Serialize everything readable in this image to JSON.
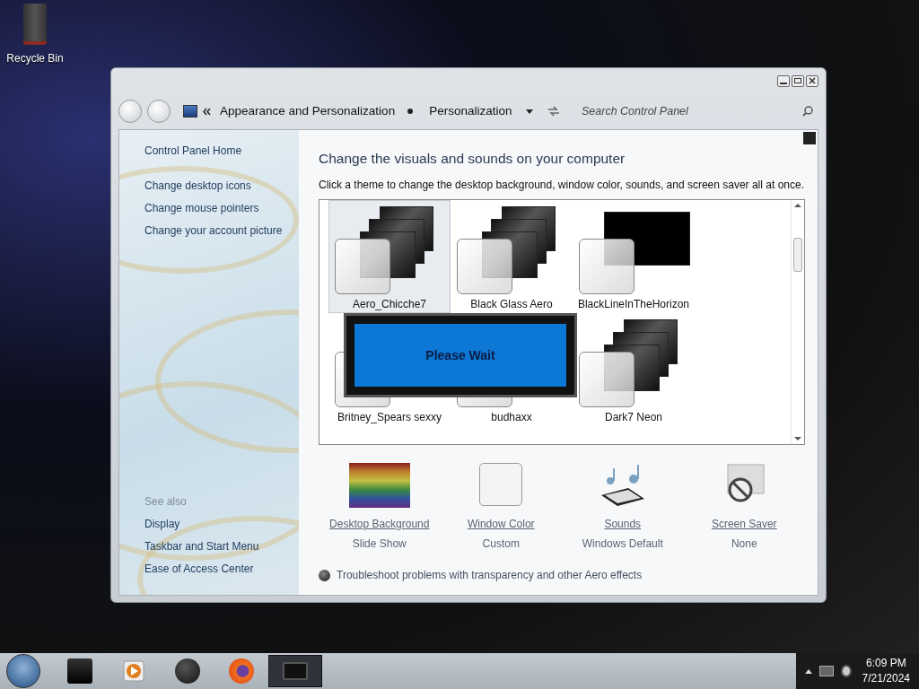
{
  "desktop_icons": [
    {
      "label": "Recycle Bin"
    }
  ],
  "window": {
    "crumbs": [
      "Appearance and Personalization",
      "Personalization"
    ],
    "search": {
      "placeholder": "Search Control Panel"
    },
    "sidebar": {
      "links": [
        "Control Panel Home",
        "Change desktop icons",
        "Change mouse pointers",
        "Change your account picture"
      ],
      "see_also_heading": "See also",
      "see_also": [
        "Display",
        "Taskbar and Start Menu",
        "Ease of Access Center"
      ]
    },
    "heading": "Change the visuals and sounds on your computer",
    "description": "Click a theme to change the desktop background, window color, sounds, and screen saver all at once.",
    "themes": [
      {
        "name": "Aero_Chicche7",
        "selected": true,
        "kind": "stack"
      },
      {
        "name": "Black Glass Aero",
        "selected": false,
        "kind": "stack"
      },
      {
        "name": "BlackLineInTheHorizon",
        "selected": false,
        "kind": "single"
      },
      {
        "name": "Britney_Spears sexxy",
        "selected": false,
        "kind": "blank"
      },
      {
        "name": "budhaxx",
        "selected": false,
        "kind": "blank"
      },
      {
        "name": "Dark7 Neon",
        "selected": false,
        "kind": "stack"
      }
    ],
    "overlay": {
      "text": "Please Wait"
    },
    "settings": [
      {
        "kind": "background",
        "title": "Desktop Background",
        "value": "Slide Show"
      },
      {
        "kind": "color",
        "title": "Window Color",
        "value": "Custom"
      },
      {
        "kind": "sounds",
        "title": "Sounds",
        "value": "Windows Default"
      },
      {
        "kind": "saver",
        "title": "Screen Saver",
        "value": "None"
      }
    ],
    "help_link": "Troubleshoot problems with transparency and other Aero effects"
  },
  "taskbar": {
    "apps": [
      {
        "kind": "folder",
        "selected": false
      },
      {
        "kind": "media",
        "selected": false
      },
      {
        "kind": "globe",
        "selected": false
      },
      {
        "kind": "browser",
        "selected": false
      },
      {
        "kind": "window",
        "selected": true
      }
    ],
    "clock": {
      "time": "6:09 PM",
      "date": "7/21/2024"
    }
  }
}
